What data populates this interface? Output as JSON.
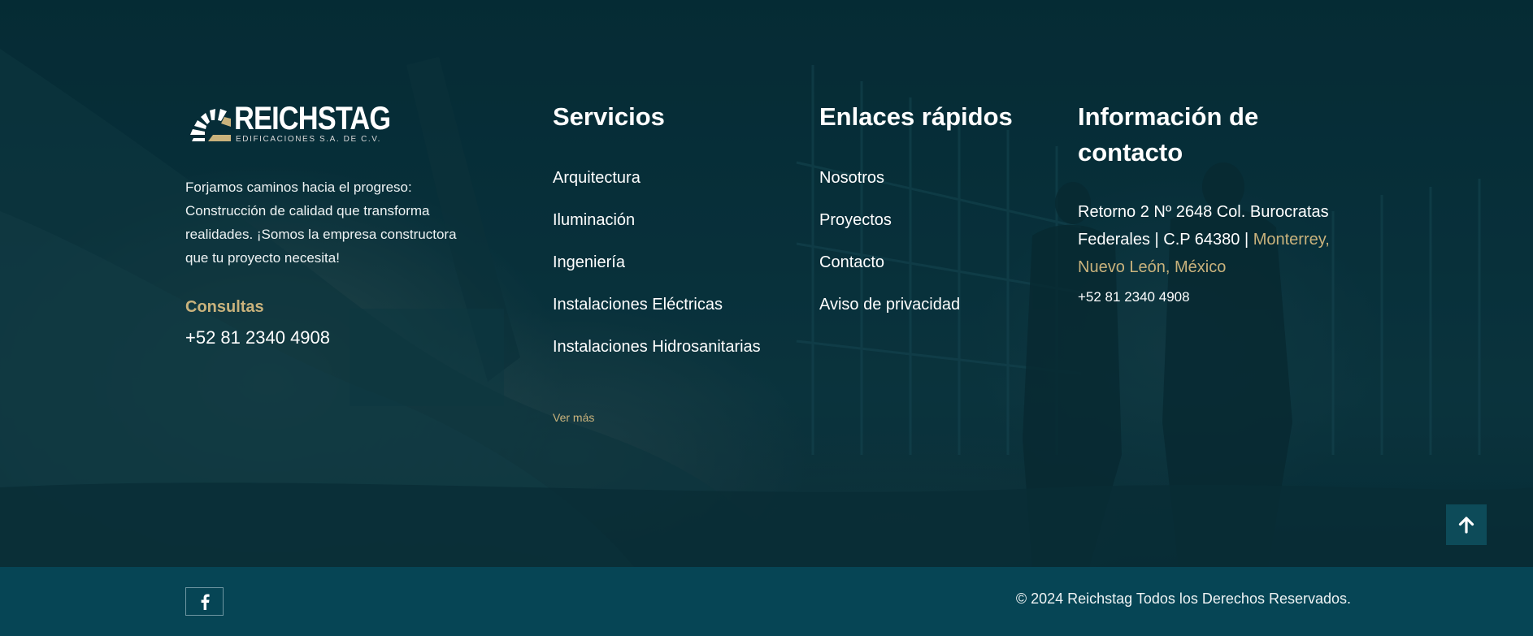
{
  "brand": {
    "logo_name": "REICHSTAG",
    "logo_subtitle": "EDIFICACIONES S.A. DE C.V.",
    "description": "Forjamos caminos hacia el progreso: Construcción de calidad que transforma realidades. ¡Somos la empresa constructora que tu proyecto necesita!",
    "consultas_label": "Consultas",
    "consultas_phone": "+52 81 2340 4908"
  },
  "services": {
    "title": "Servicios",
    "items": [
      {
        "label": "Arquitectura"
      },
      {
        "label": "Iluminación"
      },
      {
        "label": "Ingeniería"
      },
      {
        "label": "Instalaciones Eléctricas"
      },
      {
        "label": "Instalaciones Hidrosanitarias"
      }
    ],
    "more_label": "Ver más"
  },
  "quick_links": {
    "title": "Enlaces rápidos",
    "items": [
      {
        "label": "Nosotros"
      },
      {
        "label": "Proyectos"
      },
      {
        "label": "Contacto"
      },
      {
        "label": "Aviso de privacidad"
      }
    ]
  },
  "contact": {
    "title": "Información de contacto",
    "address_plain": "Retorno 2 Nº 2648 Col. Burocratas Federales | C.P 64380 |",
    "address_highlight": "Monterrey, Nuevo León, México",
    "phone": "+52 81 2340 4908"
  },
  "footer": {
    "copyright": "© 2024 Reichstag Todos los Derechos Reservados.",
    "social_icon": "facebook-icon"
  },
  "icons": {
    "scroll_top": "arrow-up-icon"
  },
  "colors": {
    "accent_gold": "#c9b27c",
    "bottom_bar": "#064555",
    "scroll_button": "#0d4b59"
  }
}
